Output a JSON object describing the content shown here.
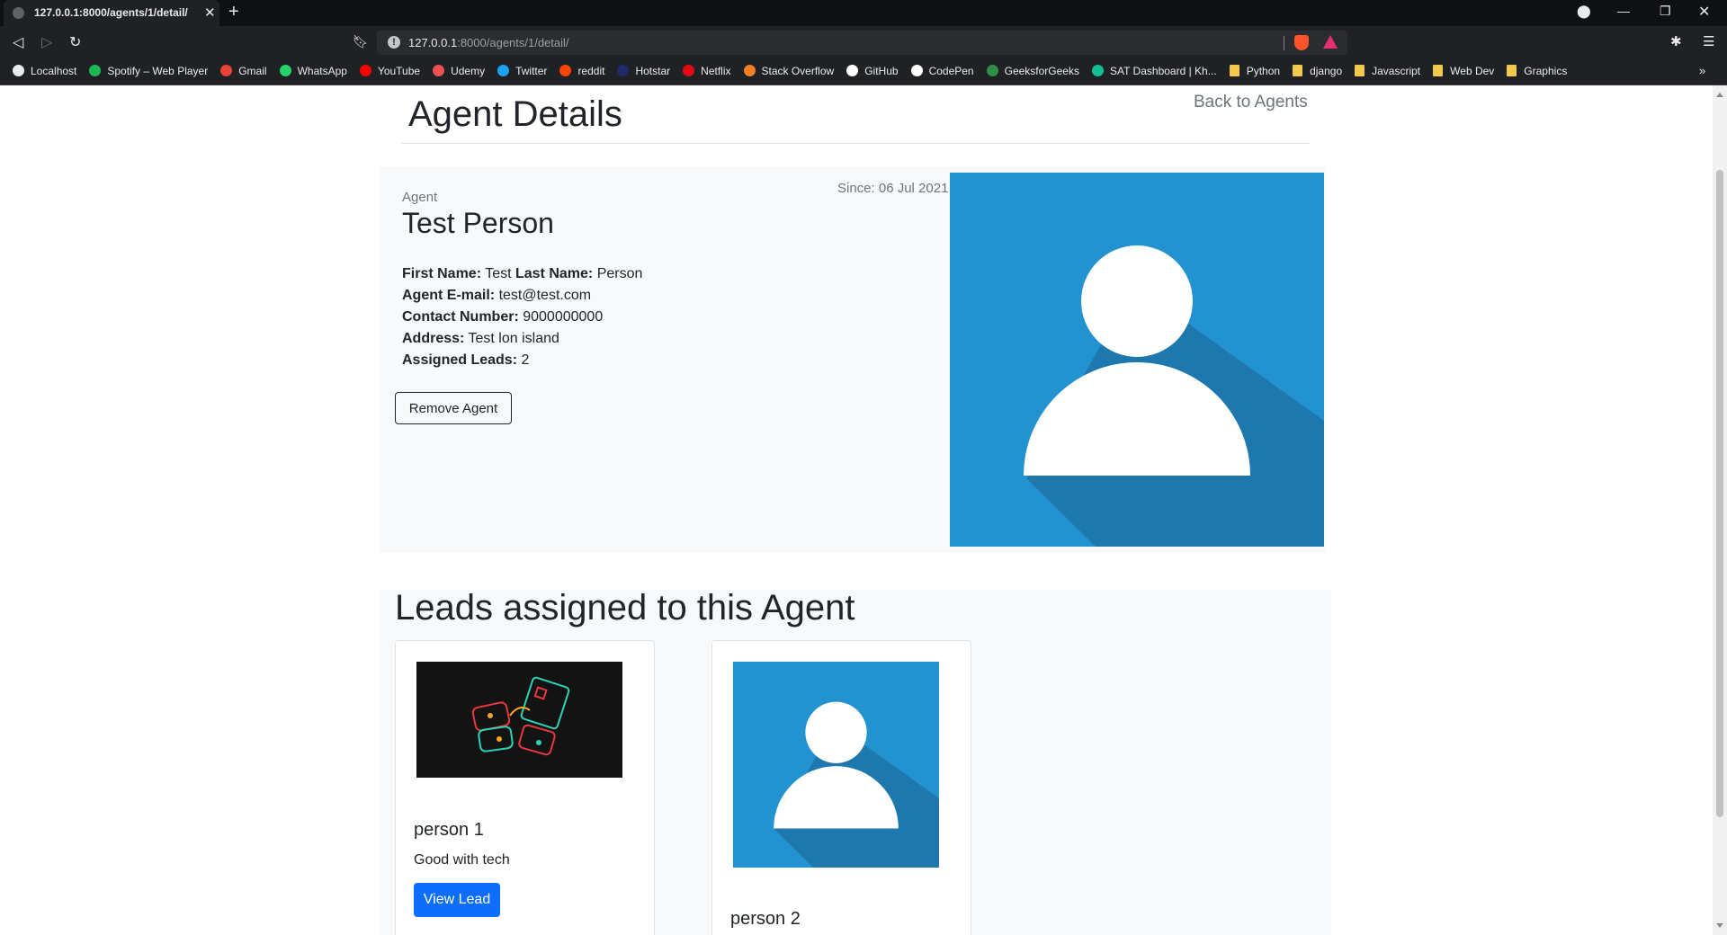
{
  "browser": {
    "tab_title": "127.0.0.1:8000/agents/1/detail/",
    "url_host": "127.0.0.1",
    "url_path": ":8000/agents/1/detail/",
    "bookmarks": [
      {
        "label": "Localhost",
        "icon": "globe-icon",
        "color": "#e8eaed"
      },
      {
        "label": "Spotify – Web Player",
        "icon": "spotify-icon",
        "color": "#1db954"
      },
      {
        "label": "Gmail",
        "icon": "gmail-icon",
        "color": "#ea4335"
      },
      {
        "label": "WhatsApp",
        "icon": "whatsapp-icon",
        "color": "#25d366"
      },
      {
        "label": "YouTube",
        "icon": "youtube-icon",
        "color": "#ff0000"
      },
      {
        "label": "Udemy",
        "icon": "udemy-icon",
        "color": "#ec5252"
      },
      {
        "label": "Twitter",
        "icon": "twitter-icon",
        "color": "#1da1f2"
      },
      {
        "label": "reddit",
        "icon": "reddit-icon",
        "color": "#ff4500"
      },
      {
        "label": "Hotstar",
        "icon": "hotstar-icon",
        "color": "#1f2a6b"
      },
      {
        "label": "Netflix",
        "icon": "netflix-icon",
        "color": "#e50914"
      },
      {
        "label": "Stack Overflow",
        "icon": "stackoverflow-icon",
        "color": "#f48024"
      },
      {
        "label": "GitHub",
        "icon": "github-icon",
        "color": "#ffffff"
      },
      {
        "label": "CodePen",
        "icon": "codepen-icon",
        "color": "#ffffff"
      },
      {
        "label": "GeeksforGeeks",
        "icon": "geeksforgeeks-icon",
        "color": "#2f8d46"
      },
      {
        "label": "SAT Dashboard | Kh...",
        "icon": "khan-academy-icon",
        "color": "#14bf96"
      },
      {
        "label": "Python",
        "icon": "folder-icon",
        "color": "#f2c94c"
      },
      {
        "label": "django",
        "icon": "folder-icon",
        "color": "#f2c94c"
      },
      {
        "label": "Javascript",
        "icon": "folder-icon",
        "color": "#f2c94c"
      },
      {
        "label": "Web Dev",
        "icon": "folder-icon",
        "color": "#f2c94c"
      },
      {
        "label": "Graphics",
        "icon": "folder-icon",
        "color": "#f2c94c"
      }
    ]
  },
  "page": {
    "heading": "Agent Details",
    "back_link": "Back to Agents",
    "agent": {
      "role_label": "Agent",
      "since": "Since: 06 Jul 2021",
      "name": "Test Person",
      "first_name_label": "First Name:",
      "first_name": "Test",
      "last_name_label": "Last Name:",
      "last_name": "Person",
      "email_label": "Agent E-mail:",
      "email": "test@test.com",
      "contact_label": "Contact Number:",
      "contact": "9000000000",
      "address_label": "Address:",
      "address": "Test lon island",
      "leads_label": "Assigned Leads:",
      "leads_count": "2",
      "remove_button": "Remove Agent"
    },
    "leads_heading": "Leads assigned to this Agent",
    "leads": [
      {
        "name": "person 1",
        "description": "Good with tech",
        "button": "View Lead"
      },
      {
        "name": "person 2"
      }
    ]
  },
  "colors": {
    "avatar_bg": "#2292d0",
    "avatar_shadow": "#1f78ad",
    "primary_button": "#0d6efd",
    "panel_bg": "#f8f9fa"
  }
}
